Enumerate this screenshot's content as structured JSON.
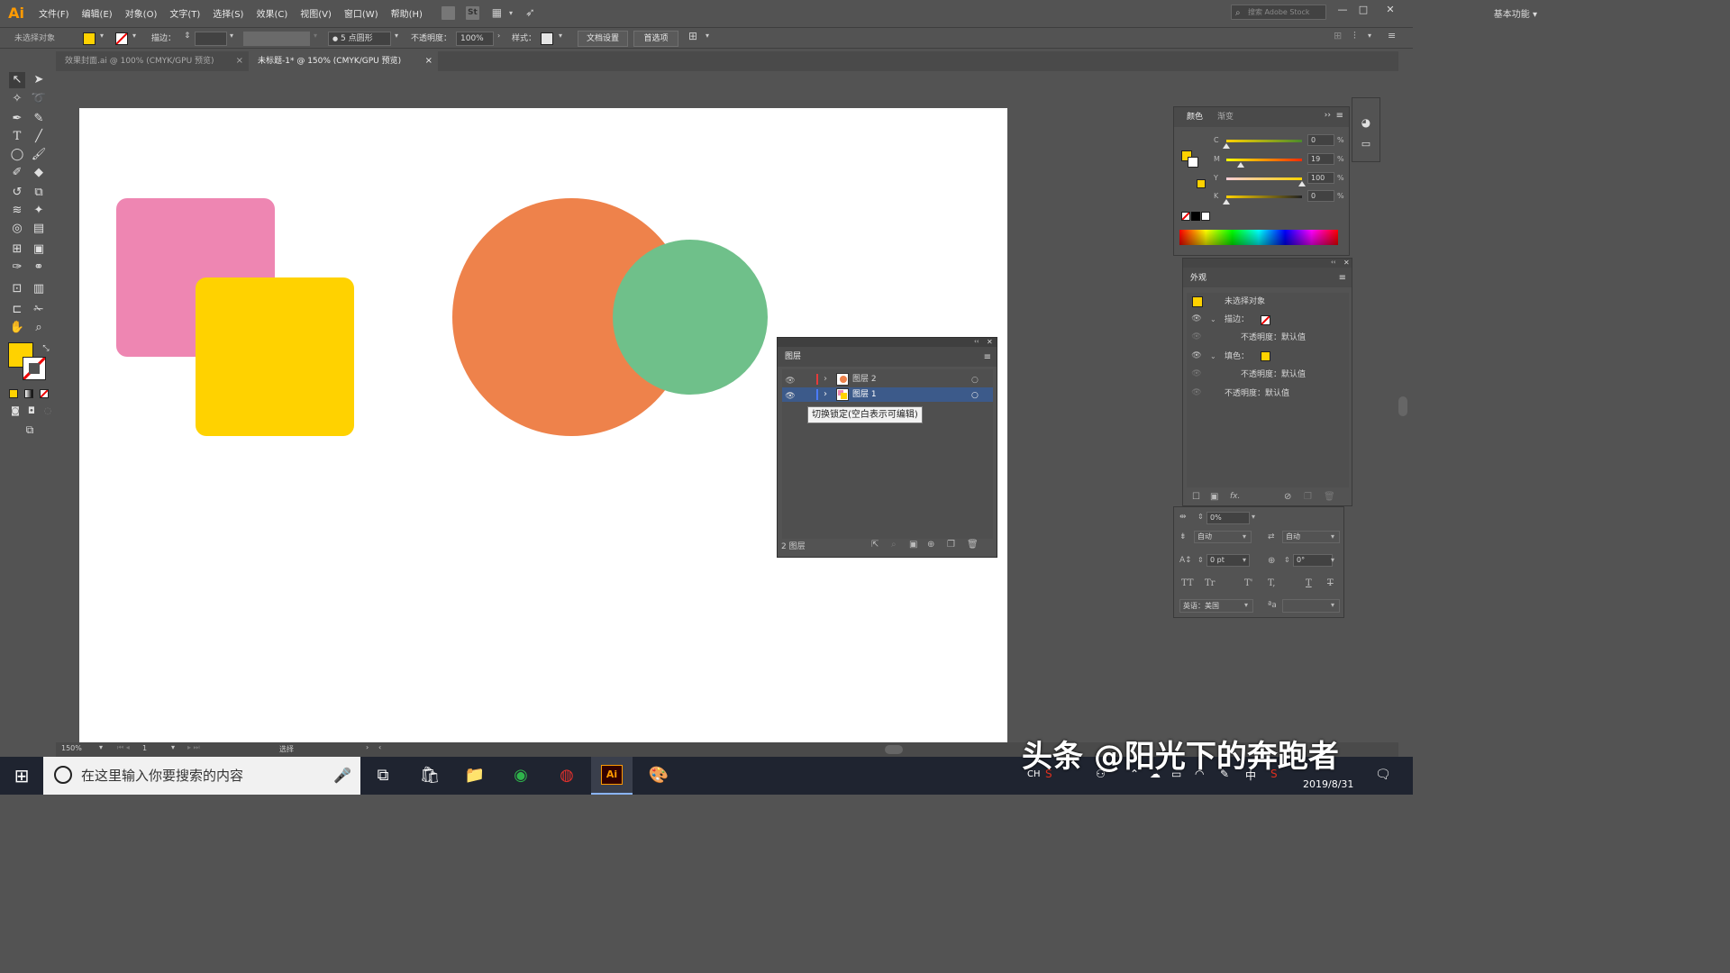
{
  "app": {
    "logo": "Ai"
  },
  "menubar": {
    "items": [
      "文件(F)",
      "编辑(E)",
      "对象(O)",
      "文字(T)",
      "选择(S)",
      "效果(C)",
      "视图(V)",
      "窗口(W)",
      "帮助(H)"
    ],
    "st_label": "St",
    "workspace": "基本功能",
    "search_placeholder": "搜索 Adobe Stock",
    "min": "—",
    "max": "□",
    "close": "✕"
  },
  "controlbar": {
    "selection": "未选择对象",
    "stroke_label": "描边：",
    "brush": "5 点圆形",
    "opacity_label": "不透明度：",
    "opacity_value": "100%",
    "style_label": "样式：",
    "doc_setup": "文档设置",
    "prefs": "首选项",
    "fill_color": "#ffd200"
  },
  "tabs": [
    {
      "label": "效果封面.ai @ 100% (CMYK/GPU 预览)",
      "close": "×",
      "active": false
    },
    {
      "label": "未标题-1* @ 150% (CMYK/GPU 预览)",
      "close": "×",
      "active": true
    }
  ],
  "shapes": {
    "pink": "#ee86b2",
    "yellow": "#ffd200",
    "orange": "#ee824b",
    "green": "#6fc08a"
  },
  "color_panel": {
    "tabs": [
      "颜色",
      "渐变"
    ],
    "channels": [
      {
        "name": "C",
        "value": "0",
        "unit": "%",
        "level": 0.0
      },
      {
        "name": "M",
        "value": "19",
        "unit": "%",
        "level": 0.19
      },
      {
        "name": "Y",
        "value": "100",
        "unit": "%",
        "level": 1.0
      },
      {
        "name": "K",
        "value": "0",
        "unit": "%",
        "level": 0.0
      }
    ]
  },
  "appearance_panel": {
    "title": "外观",
    "object": "未选择对象",
    "stroke": "描边：",
    "stroke_opacity": "不透明度：默认值",
    "fill": "填色：",
    "fill_opacity": "不透明度：默认值",
    "opacity": "不透明度：默认值",
    "fx": "fx."
  },
  "char_panel": {
    "tracking": "0%",
    "auto1": "自动",
    "auto2": "自动",
    "baseline": "0 pt",
    "rotate": "0°",
    "language": "英语：美国",
    "tt": "TT",
    "tr": "Tr",
    "tsup": "T'",
    "tsub": "T,",
    "tu": "T",
    "ts": "T"
  },
  "layers_panel": {
    "title": "图层",
    "layers": [
      {
        "name": "图层 2",
        "color": "#e63b3b"
      },
      {
        "name": "图层 1",
        "color": "#4a7bff"
      }
    ],
    "count": "2 图层",
    "tooltip": "切换锁定(空白表示可编辑)"
  },
  "statusbar": {
    "zoom": "150%",
    "page": "1",
    "mode": "选择"
  },
  "taskbar": {
    "search_placeholder": "在这里输入你要搜索的内容",
    "ai_label": "Ai",
    "lang": "CH",
    "ime": "中",
    "date": "2019/8/31"
  },
  "watermark": "头条 @阳光下的奔跑者"
}
